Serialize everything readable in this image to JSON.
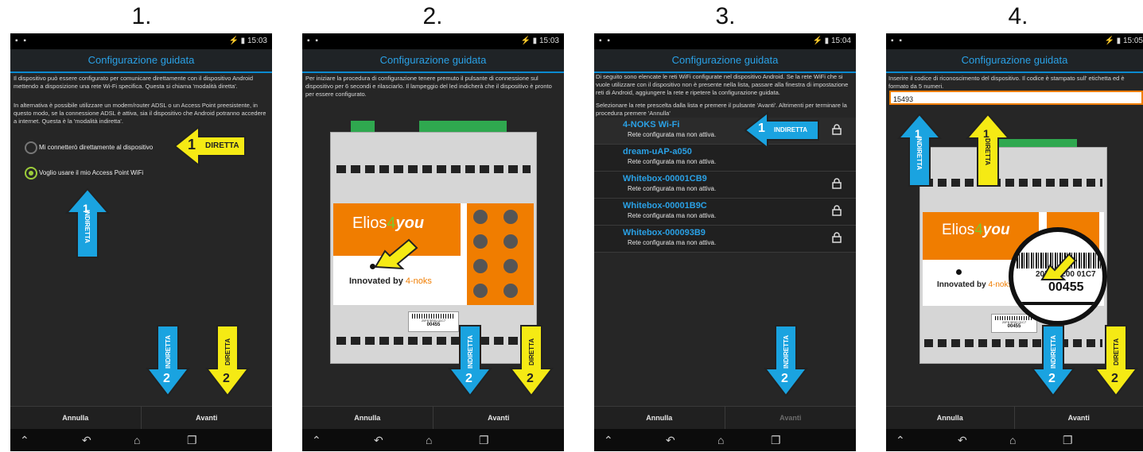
{
  "steps": [
    "1.",
    "2.",
    "3.",
    "4."
  ],
  "status": {
    "left_icons": "▪ ▪",
    "time1": "⚡ ▮ 15:03",
    "time2": "⚡ ▮ 15:03",
    "time3": "⚡ ▮ 15:04",
    "time4": "⚡ ▮ 15:05"
  },
  "window_title": "Configurazione guidata",
  "screen1": {
    "para1": "Il dispositivo può essere configurato per comunicare direttamente con il dispositivo Android mettendo a disposizione una rete Wi-Fi specifica. Questa si chiama 'modalità diretta'.",
    "para2": "In alternativa è possibile utilizzare un modem/router ADSL o un Access Point preesistente, in questo modo, se la connessione ADSL è attiva, sia il dispositivo che Android potranno accedere a internet. Questa è la 'modalità indiretta'.",
    "option_direct": "Mi connetterò direttamente al dispositivo",
    "option_ap": "Voglio usare il mio Access Point WiFi"
  },
  "screen2": {
    "para": "Per iniziare la procedura di configurazione tenere premuto il pulsante di connessione sul dispositivo per 6 secondi e rilasciarlo. Il lampeggio del led indicherà che il dispositivo è pronto per essere configurato."
  },
  "screen3": {
    "para1": "Di seguito sono elencate le reti WiFi configurate nel dispositivo Android. Se la rete WiFi che si vuole utilizzare con il dispositivo non è presente nella lista, passare alla finestra di impostazione reti di Android, aggiungere la rete e ripetere la configurazione guidata.",
    "para2": "Selezionare la rete prescelta dalla lista e premere il pulsante 'Avanti'. Altrimenti per terminare la procedura premere 'Annulla'",
    "networks": [
      {
        "name": "4-NOKS Wi-Fi",
        "status": "Rete configurata ma non attiva."
      },
      {
        "name": "dream-uAP-a050",
        "status": "Rete configurata ma non attiva."
      },
      {
        "name": "Whitebox-00001CB9",
        "status": "Rete configurata ma non attiva."
      },
      {
        "name": "Whitebox-00001B9C",
        "status": "Rete configurata ma non attiva."
      },
      {
        "name": "Whitebox-000093B9",
        "status": "Rete configurata ma non attiva."
      }
    ]
  },
  "screen4": {
    "para": "Inserire il codice di riconoscimento del dispositivo. Il codice è stampato sull' etichetta ed è formato da 5 numeri.",
    "input_value": "15493",
    "zoom_code_top": "20F8 5E00 01C7",
    "zoom_code": "00455"
  },
  "device": {
    "brand_a": "Elios",
    "brand_b": "4",
    "brand_c": "you",
    "innovated": "Innovated by ",
    "innovated_brand": "4-noks",
    "label_small": "20F8 5E00 01C7",
    "label_code": "00455"
  },
  "buttons": {
    "cancel": "Annulla",
    "next": "Avanti"
  },
  "arrows": {
    "diretta": "DIRETTA",
    "indiretta": "INDIRETTA",
    "one": "1",
    "two": "2"
  },
  "colors": {
    "yellow": "#f5ea14",
    "blue": "#1aa3e0",
    "orange": "#f07d00",
    "green": "#2fa84f",
    "accent": "#2aa1e6"
  }
}
